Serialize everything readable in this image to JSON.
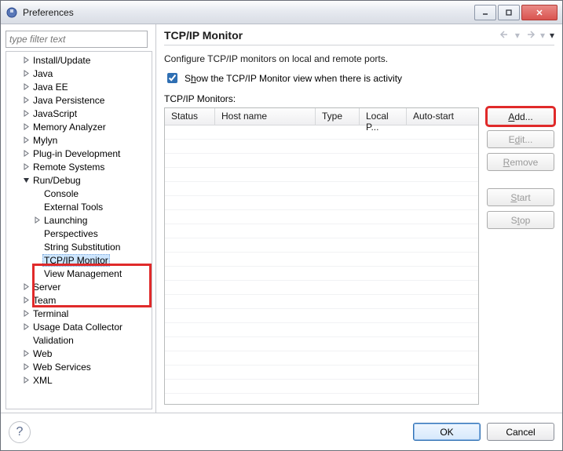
{
  "window": {
    "title": "Preferences"
  },
  "filter": {
    "placeholder": "type filter text"
  },
  "tree": {
    "install_update": "Install/Update",
    "java": "Java",
    "java_ee": "Java EE",
    "java_persistence": "Java Persistence",
    "javascript": "JavaScript",
    "memory_analyzer": "Memory Analyzer",
    "mylyn": "Mylyn",
    "plugin_dev": "Plug-in Development",
    "remote_systems": "Remote Systems",
    "run_debug": "Run/Debug",
    "console": "Console",
    "external_tools": "External Tools",
    "launching": "Launching",
    "perspectives": "Perspectives",
    "string_sub": "String Substitution",
    "tcpip_monitor": "TCP/IP Monitor",
    "view_mgmt": "View Management",
    "server": "Server",
    "team": "Team",
    "terminal": "Terminal",
    "usage_data": "Usage Data Collector",
    "validation": "Validation",
    "web": "Web",
    "web_services": "Web Services",
    "xml": "XML"
  },
  "page": {
    "heading": "TCP/IP Monitor",
    "description": "Configure TCP/IP monitors on local and remote ports.",
    "checkbox_pre": "S",
    "checkbox_u": "h",
    "checkbox_post": "ow the TCP/IP Monitor view when there is activity",
    "monitors_label": "TCP/IP Monitors:",
    "columns": {
      "status": "Status",
      "host": "Host name",
      "type": "Type",
      "localp": "Local P...",
      "autostart": "Auto-start"
    },
    "buttons": {
      "add_u": "A",
      "add_post": "dd...",
      "edit_pre": "E",
      "edit_u": "d",
      "edit_post": "it...",
      "remove_u": "R",
      "remove_post": "emove",
      "start_u": "S",
      "start_post": "tart",
      "stop_pre": "S",
      "stop_u": "t",
      "stop_post": "op"
    }
  },
  "footer": {
    "ok": "OK",
    "cancel": "Cancel"
  }
}
